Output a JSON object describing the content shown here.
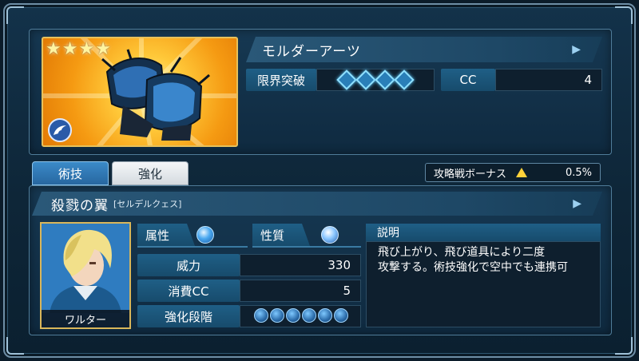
{
  "item": {
    "stars": [
      "★",
      "★",
      "★",
      "★"
    ],
    "name": "モルダーアーツ",
    "icon": "gauntlet-icon",
    "type_badge_icon": "wing-icon"
  },
  "limit_break": {
    "label": "限界突破",
    "level": 4,
    "max": 4
  },
  "cc": {
    "label": "CC",
    "value": "4"
  },
  "tabs": [
    {
      "label": "術技",
      "active": true
    },
    {
      "label": "強化",
      "active": false
    }
  ],
  "bonus": {
    "label": "攻略戦ボーナス",
    "icon": "up-arrow-icon",
    "value": "0.5%"
  },
  "skill": {
    "name": "殺戮の翼",
    "reading": "[セルデルクェス]",
    "character_name": "ワルター",
    "attribute_label": "属性",
    "attribute_icon": "water-element-icon",
    "nature_label": "性質",
    "nature_icon": "spiral-nature-icon",
    "power_label": "威力",
    "power_value": "330",
    "cost_label": "消費CC",
    "cost_value": "5",
    "enhance_label": "強化段階",
    "enhance_level": 6,
    "desc_label": "説明",
    "desc_line1": "飛び上がり、飛び道具により二度",
    "desc_line2": "攻撃する。術技強化で空中でも連携可"
  },
  "colors": {
    "accent": "#1f5f86",
    "gold": "#e8c15a",
    "bonus_arrow": "#ffd23a",
    "background": "#0e2638"
  }
}
